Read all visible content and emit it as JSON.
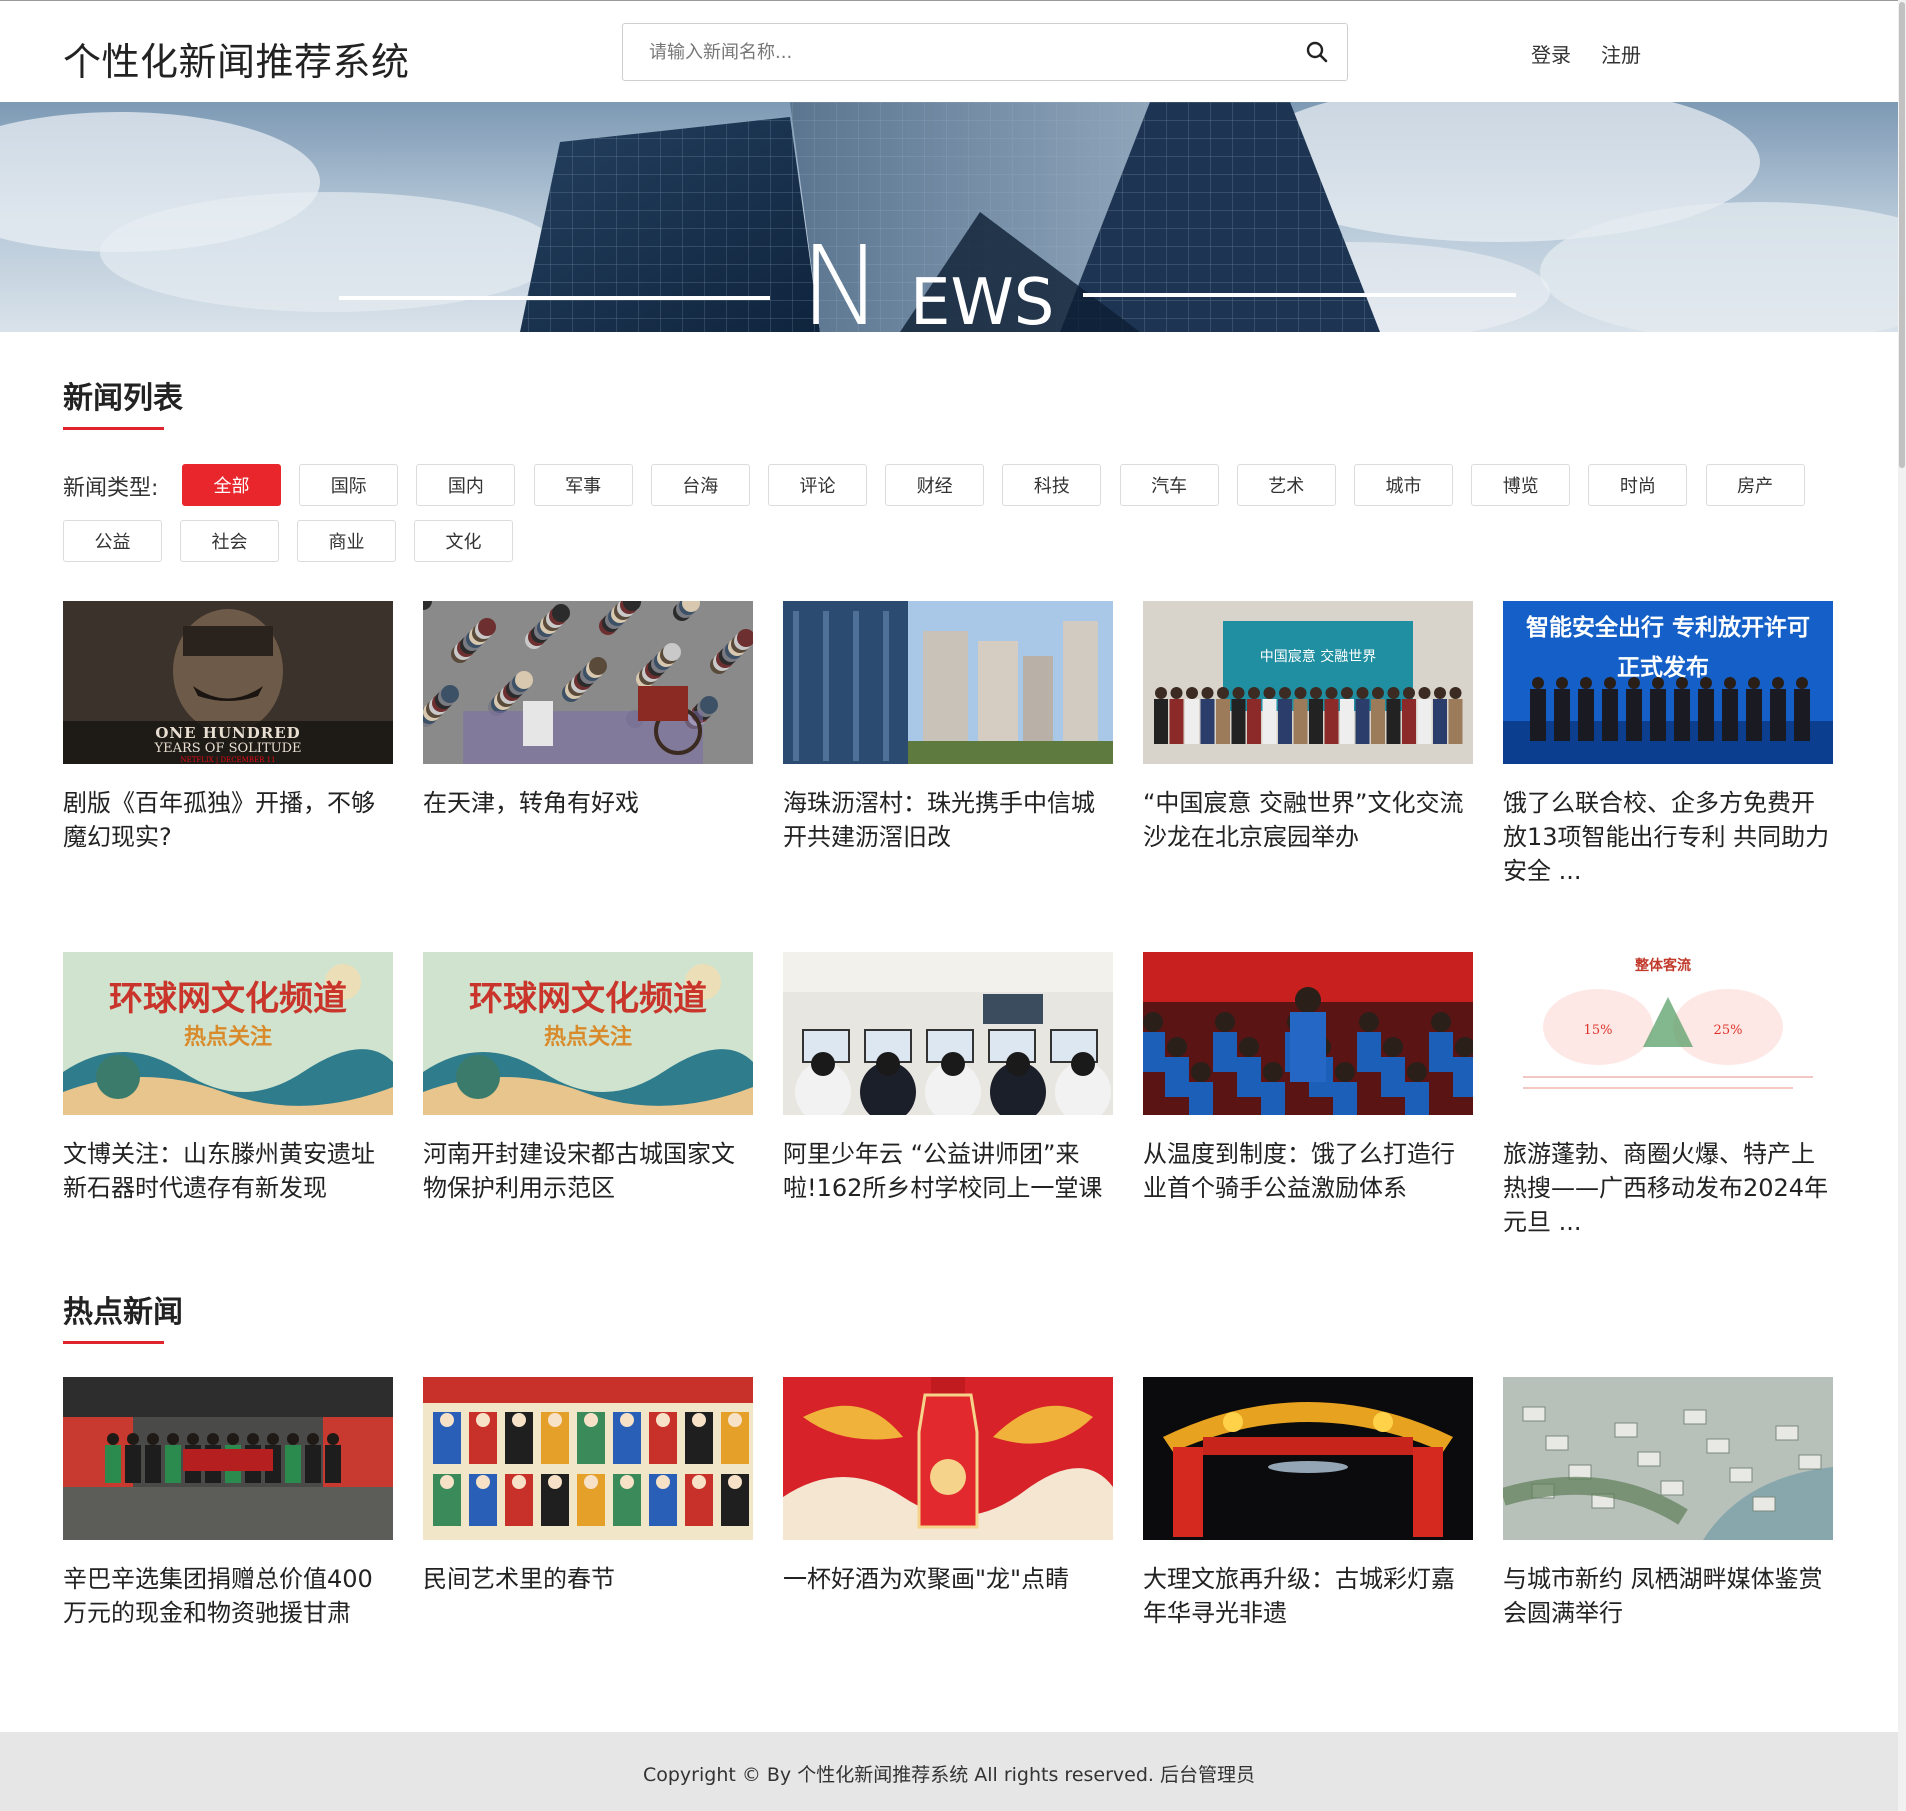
{
  "header": {
    "site_title": "个性化新闻推荐系统",
    "search_placeholder": "请输入新闻名称...",
    "login": "登录",
    "register": "注册"
  },
  "banner": {
    "letter_big": "N",
    "letters_rest": "EWS"
  },
  "news_list": {
    "title": "新闻列表",
    "filter_label": "新闻类型:",
    "categories": [
      "全部",
      "国际",
      "国内",
      "军事",
      "台海",
      "评论",
      "财经",
      "科技",
      "汽车",
      "艺术",
      "城市",
      "博览",
      "时尚",
      "房产",
      "公益",
      "社会",
      "商业",
      "文化"
    ],
    "active_category": "全部",
    "items": [
      {
        "title": "剧版《百年孤独》开播，不够魔幻现实?",
        "image": "netflix-poster",
        "image_text": [
          "ONE HUNDRED",
          "YEARS OF SOLITUDE",
          "NETFLIX | DECEMBER 11"
        ]
      },
      {
        "title": "在天津，转角有好戏",
        "image": "street-performance-crowd"
      },
      {
        "title": "海珠沥滘村：珠光携手中信城开共建沥滘旧改",
        "image": "city-skyscrapers"
      },
      {
        "title": "“中国宸意 交融世界”文化交流沙龙在北京宸园举办",
        "image": "group-photo-event",
        "image_text": [
          "中国宸意 交融世界"
        ]
      },
      {
        "title": "饿了么联合校、企多方免费开放13项智能出行专利 共同助力安全 ...",
        "image": "launch-ceremony",
        "image_text": [
          "智能安全出行 专利放开许可",
          "正式发布"
        ]
      },
      {
        "title": "文博关注：山东滕州黄安遗址新石器时代遗存有新发现",
        "image": "culture-channel-banner",
        "image_text": [
          "环球网文化频道",
          "热点关注"
        ]
      },
      {
        "title": "河南开封建设宋都古城国家文物保护利用示范区",
        "image": "culture-channel-banner",
        "image_text": [
          "环球网文化频道",
          "热点关注"
        ]
      },
      {
        "title": "阿里少年云 “公益讲师团”来啦!162所乡村学校同上一堂课",
        "image": "computer-classroom"
      },
      {
        "title": "从温度到制度：饿了么打造行业首个骑手公益激励体系",
        "image": "rider-gathering"
      },
      {
        "title": "旅游蓬勃、商圈火爆、特产上热搜——广西移动发布2024年元旦 ...",
        "image": "tourism-flow-infographic",
        "image_text": [
          "整体客流",
          "15%",
          "25%"
        ]
      }
    ]
  },
  "hot_news": {
    "title": "热点新闻",
    "items": [
      {
        "title": "辛巴辛选集团捐赠总价值400万元的现金和物资驰援甘肃",
        "image": "donation-group-photo"
      },
      {
        "title": "民间艺术里的春节",
        "image": "folk-art-painting"
      },
      {
        "title": "一杯好酒为欢聚画\"龙\"点睛",
        "image": "dragon-bottle-ad"
      },
      {
        "title": "大理文旅再升级：古城彩灯嘉年华寻光非遗",
        "image": "dragon-lantern-gate"
      },
      {
        "title": "与城市新约 凤栖湖畔媒体鉴赏会圆满举行",
        "image": "aerial-city-view"
      }
    ]
  },
  "footer": {
    "copyright": "Copyright © By 个性化新闻推荐系统 All rights reserved.",
    "admin_link": "后台管理员"
  },
  "colors": {
    "accent": "#e8262c",
    "footer_bg": "#e6e6e6",
    "underline": "#e0242d"
  }
}
